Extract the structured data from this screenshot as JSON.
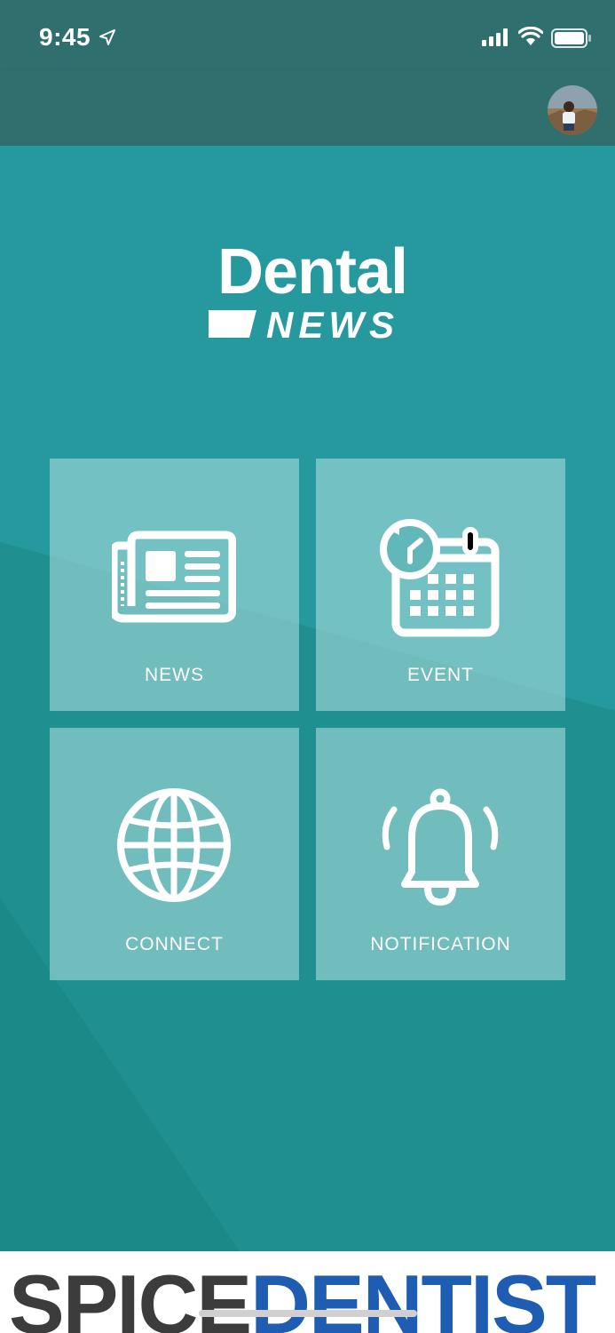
{
  "status_bar": {
    "time": "9:45"
  },
  "logo": {
    "title": "Dental",
    "subtitle": "NEWS"
  },
  "menu": {
    "tiles": [
      {
        "label": "NEWS",
        "icon": "newspaper-icon"
      },
      {
        "label": "EVENT",
        "icon": "calendar-clock-icon"
      },
      {
        "label": "CONNECT",
        "icon": "globe-icon"
      },
      {
        "label": "NOTIFICATION",
        "icon": "bell-icon"
      }
    ]
  },
  "ad": {
    "text_dark": "SPICE",
    "text_blue": "DENTIST"
  },
  "colors": {
    "header": "#2f6f6e",
    "background": "#25999e",
    "tile": "#b4e1e1",
    "ad_dark": "#3c3c3c",
    "ad_blue": "#1e5db1"
  }
}
